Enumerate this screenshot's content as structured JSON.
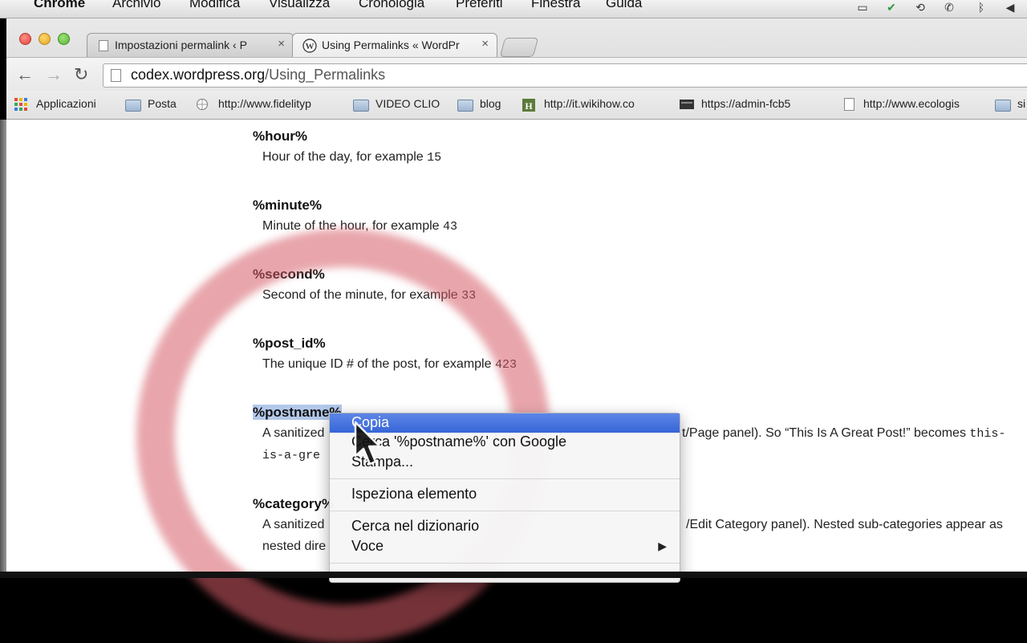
{
  "menubar": {
    "app": "Chrome",
    "items": [
      "Archivio",
      "Modifica",
      "Visualizza",
      "Cronologia",
      "Preferiti",
      "Finestra",
      "Guida"
    ]
  },
  "tabs": [
    {
      "title": "Impostazioni permalink ‹ P",
      "close": "×"
    },
    {
      "title": "Using Permalinks « WordPr",
      "close": "×"
    }
  ],
  "omnibox": {
    "domain": "codex.wordpress.org",
    "path": "/Using_Permalinks"
  },
  "bookmarks": [
    {
      "label": "Applicazioni",
      "icon": "apps-grid-icon"
    },
    {
      "label": "Posta",
      "icon": "folder-icon"
    },
    {
      "label": "http://www.fidelityp",
      "icon": "globe-icon"
    },
    {
      "label": "VIDEO CLIO",
      "icon": "folder-icon"
    },
    {
      "label": "blog",
      "icon": "folder-icon"
    },
    {
      "label": "http://it.wikihow.co",
      "icon": "wikihow-icon"
    },
    {
      "label": "https://admin-fcb5",
      "icon": "dark-page-icon"
    },
    {
      "label": "http://www.ecologis",
      "icon": "page-icon"
    },
    {
      "label": "si",
      "icon": "folder-icon"
    }
  ],
  "doc": {
    "entries": [
      {
        "term": "%hour%",
        "desc": "Hour of the day, for example ",
        "example": "15"
      },
      {
        "term": "%minute%",
        "desc": "Minute of the hour, for example ",
        "example": "43"
      },
      {
        "term": "%second%",
        "desc": "Second of the minute, for example ",
        "example": "33"
      },
      {
        "term": "%post_id%",
        "desc": "The unique ID # of the post, for example ",
        "example": "423"
      }
    ],
    "postname": {
      "term": "%postname%",
      "line1_start": "A sanitized",
      "line1_end": "t/Page panel). So “This Is A Great Post!” becomes ",
      "line1_code": "this-",
      "line2_code": "is-a-gre"
    },
    "category": {
      "term": "%category%",
      "line1_start": "A sanitized",
      "line1_end": "/Edit Category panel). Nested sub-categories appear as",
      "line2": "nested dire"
    }
  },
  "context_menu": {
    "items": [
      "Copia",
      "Cerca '%postname%' con Google",
      "Stampa...",
      "Ispeziona elemento",
      "Cerca nel dizionario",
      "Voce"
    ],
    "submenu_arrow": "▶"
  },
  "colors": {
    "highlight": "#3d6ddb",
    "selection": "#b3c8ea",
    "ring": "#d65c67"
  }
}
